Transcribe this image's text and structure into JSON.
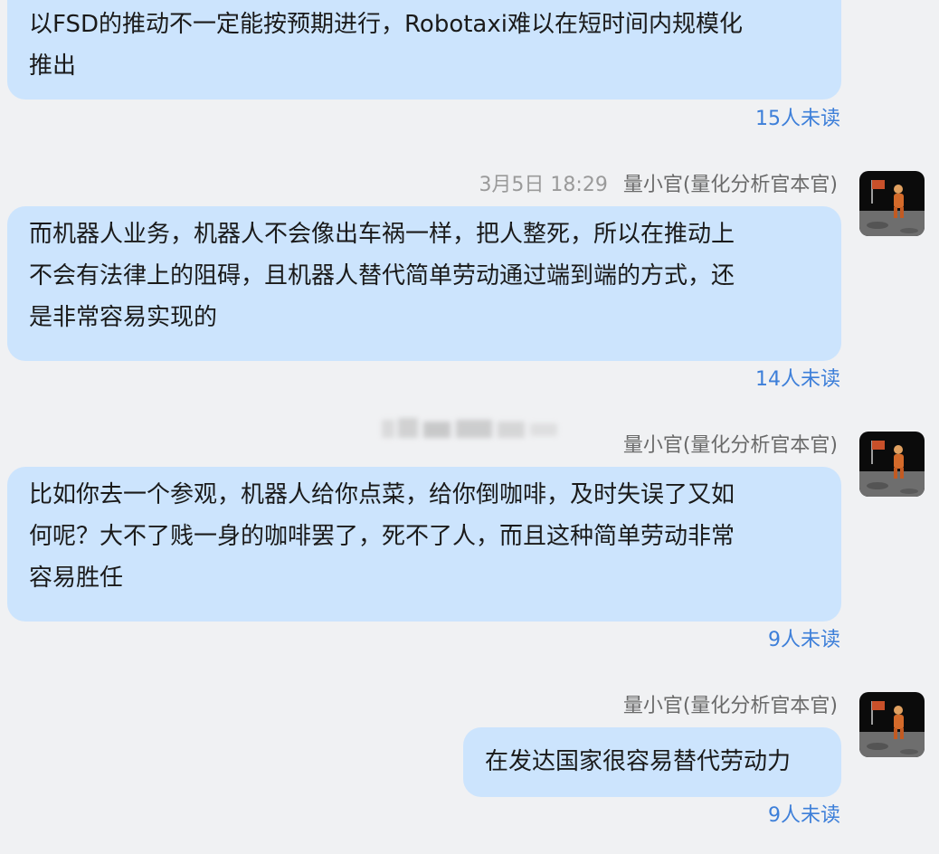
{
  "messages": [
    {
      "lines": [
        "以FSD的推动不一定能按预期进行，Robotaxi难以在短时间内规模化",
        "推出"
      ],
      "unread": "15人未读"
    },
    {
      "time": "3月5日 18:29",
      "sender": "量小官(量化分析官本官)",
      "lines": [
        "而机器人业务，机器人不会像出车祸一样，把人整死，所以在推动上",
        "不会有法律上的阻碍，且机器人替代简单劳动通过端到端的方式，还",
        "是非常容易实现的"
      ],
      "unread": "14人未读"
    },
    {
      "sender": "量小官(量化分析官本官)",
      "lines": [
        "比如你去一个参观，机器人给你点菜，给你倒咖啡，及时失误了又如",
        "何呢？大不了贱一身的咖啡罢了，死不了人，而且这种简单劳动非常",
        "容易胜任"
      ],
      "unread": "9人未读"
    },
    {
      "sender": "量小官(量化分析官本官)",
      "lines": [
        "在发达国家很容易替代劳动力"
      ],
      "unread": "9人未读"
    }
  ],
  "avatar_icon": "astronaut-on-moon-avatar",
  "colors": {
    "background": "#f0f1f3",
    "bubble": "#cce4fd",
    "unread": "#3d7fd9",
    "sender": "#6a6a6a",
    "time": "#9a9a9a"
  }
}
